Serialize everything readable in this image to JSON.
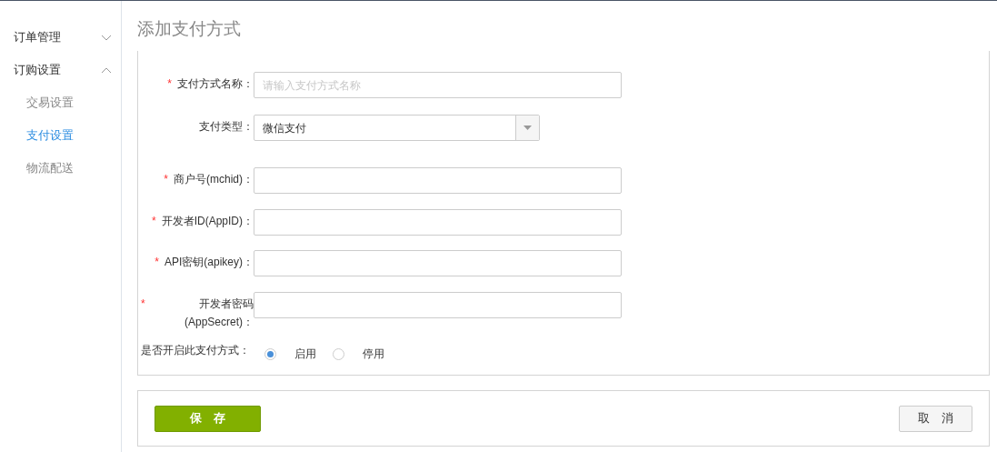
{
  "sidebar": {
    "items": [
      {
        "label": "订单管理",
        "expanded": false
      },
      {
        "label": "订购设置",
        "expanded": true,
        "children": [
          {
            "label": "交易设置",
            "selected": false
          },
          {
            "label": "支付设置",
            "selected": true
          },
          {
            "label": "物流配送",
            "selected": false
          }
        ]
      }
    ]
  },
  "page_title": "添加支付方式",
  "form": {
    "fields": [
      {
        "kind": "text",
        "required_mark": "*",
        "label": "支付方式名称：",
        "placeholder": "请输入支付方式名称"
      },
      {
        "kind": "select",
        "label": "支付类型：",
        "value": "微信支付"
      },
      {
        "kind": "text",
        "required_mark": "*",
        "label": "商户号(mchid)："
      },
      {
        "kind": "text",
        "required_mark": "*",
        "label": "开发者ID(AppID)："
      },
      {
        "kind": "text",
        "required_mark": "*",
        "label": "API密钥(apikey)："
      },
      {
        "kind": "text",
        "required_mark": "*",
        "label": "开发者密码(AppSecret)："
      },
      {
        "kind": "radio",
        "label": "是否开启此支付方式：",
        "options": [
          {
            "label": "启用",
            "selected": true
          },
          {
            "label": "停用",
            "selected": false
          }
        ]
      }
    ]
  },
  "actions": {
    "save": "保　存",
    "cancel": "取　消"
  }
}
